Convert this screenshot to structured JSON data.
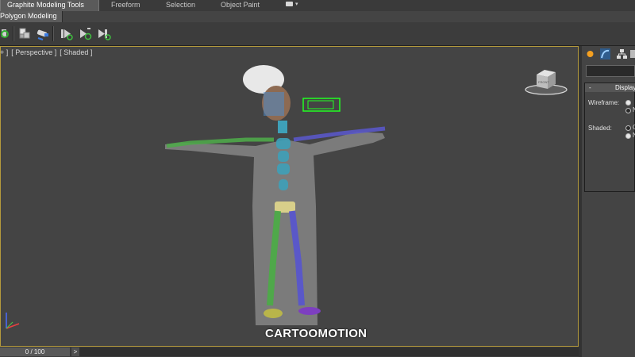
{
  "ribbon": {
    "tabs": [
      {
        "label": "Graphite Modeling Tools"
      },
      {
        "label": "Freeform"
      },
      {
        "label": "Selection"
      },
      {
        "label": "Object Paint"
      }
    ],
    "subtab": "Polygon Modeling"
  },
  "viewport": {
    "label_parts": [
      "[",
      "+ ]",
      "[ Perspective ]",
      "[ Shaded ]"
    ],
    "caption": "CARTOOMOTION",
    "viewcube_face": "FRONT"
  },
  "panel": {
    "rollout_title": "Display",
    "rollout_minus": "-",
    "wireframe_label": "Wireframe:",
    "shaded_label": "Shaded:",
    "wireframe_option2": "N",
    "shaded_option1": "O",
    "shaded_option2": "N"
  },
  "timeline": {
    "frame_display": "0 / 100",
    "next_symbol": ">"
  },
  "colors": {
    "viewport_border": "#b49a3c",
    "viewport_bg": "#444444",
    "bone_green": "#4fa84a",
    "bone_purple": "#5a58c8",
    "bone_cyan": "#3ea0b8",
    "head_box": "#22ff22"
  }
}
